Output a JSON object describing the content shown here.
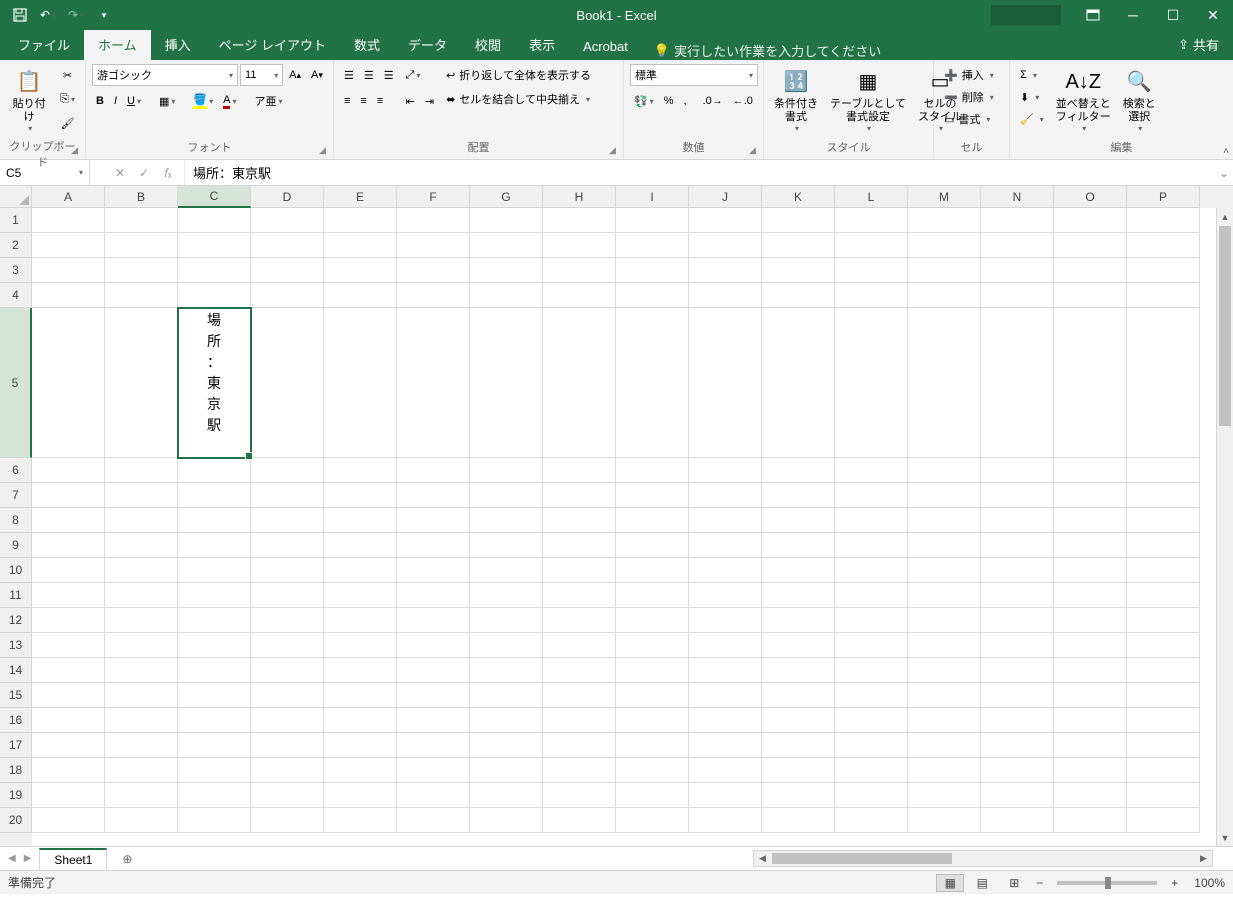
{
  "title": "Book1 - Excel",
  "qa": {
    "save": "保存",
    "undo": "元に戻す",
    "redo": "やり直し"
  },
  "tabs": {
    "file": "ファイル",
    "home": "ホーム",
    "insert": "挿入",
    "pagelayout": "ページ レイアウト",
    "formulas": "数式",
    "data": "データ",
    "review": "校閲",
    "view": "表示",
    "acrobat": "Acrobat"
  },
  "tellme": "実行したい作業を入力してください",
  "share": "共有",
  "ribbon": {
    "clipboard": {
      "label": "クリップボード",
      "paste": "貼り付け"
    },
    "font": {
      "label": "フォント",
      "name": "游ゴシック",
      "size": "11",
      "bold": "B",
      "italic": "I",
      "underline": "U"
    },
    "alignment": {
      "label": "配置",
      "wrap": "折り返して全体を表示する",
      "merge": "セルを結合して中央揃え"
    },
    "number": {
      "label": "数値",
      "format": "標準"
    },
    "styles": {
      "label": "スタイル",
      "cond": "条件付き\n書式",
      "table": "テーブルとして\n書式設定",
      "cell": "セルの\nスタイル"
    },
    "cells": {
      "label": "セル",
      "insert": "挿入",
      "delete": "削除",
      "format": "書式"
    },
    "editing": {
      "label": "編集",
      "sort": "並べ替えと\nフィルター",
      "find": "検索と\n選択"
    }
  },
  "namebox": "C5",
  "formula": "場所：東京駅",
  "columns": [
    "A",
    "B",
    "C",
    "D",
    "E",
    "F",
    "G",
    "H",
    "I",
    "J",
    "K",
    "L",
    "M",
    "N",
    "O",
    "P"
  ],
  "rows": [
    1,
    2,
    3,
    4,
    5,
    6,
    7,
    8,
    9,
    10,
    11,
    12,
    13,
    14,
    15,
    16,
    17,
    18,
    19,
    20
  ],
  "selected": {
    "col": "C",
    "row": 5
  },
  "cell_c5": "場所：東京駅",
  "sheet": "Sheet1",
  "status": "準備完了",
  "zoom": "100%"
}
